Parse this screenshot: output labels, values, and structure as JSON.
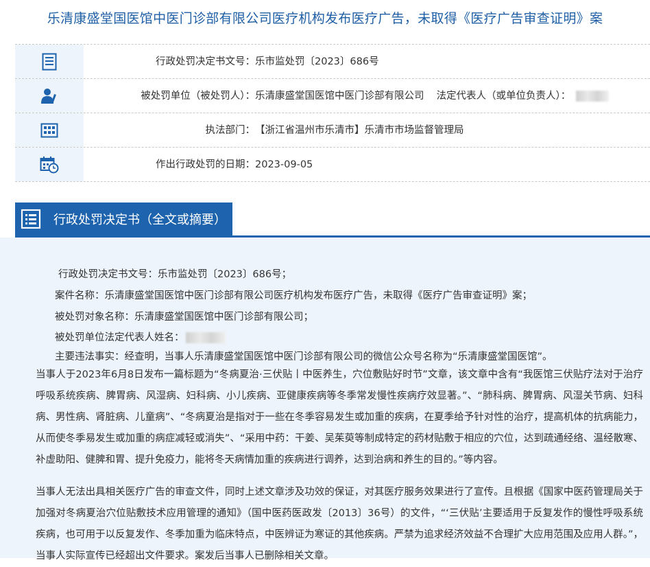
{
  "title": "乐清康盛堂国医馆中医门诊部有限公司医疗机构发布医疗广告，未取得《医疗广告审查证明》案",
  "info_rows": [
    {
      "icon": "document-icon",
      "label": "行政处罚决定书文号：",
      "value": "乐市监处罚〔2023〕686号"
    },
    {
      "icon": "user-icon",
      "label": "被处罚单位（被处罚人）：",
      "value": "乐清康盛堂国医馆中医门诊部有限公司",
      "extra_label": "法定代表人（或单位负责人）："
    },
    {
      "icon": "building-icon",
      "label": "执法部门：",
      "value": "【浙江省温州市乐清市】乐清市市场监督管理局"
    },
    {
      "icon": "calendar-clock-icon",
      "label": "作出行政处罚的日期：",
      "value": "2023-09-05"
    }
  ],
  "section": {
    "title": "行政处罚决定书（全文或摘要）",
    "icon": "document-list-icon"
  },
  "document": {
    "lines": [
      "行政处罚决定书文号：乐市监处罚〔2023〕686号；",
      "案件名称：乐清康盛堂国医馆中医门诊部有限公司医疗机构发布医疗广告，未取得《医疗广告审查证明》案；",
      "被处罚对象名称：乐清康盛堂国医馆中医门诊部有限公司；",
      "被处罚单位法定代表人姓名：",
      "主要违法事实：经查明，当事人乐清康盛堂国医馆中医门诊部有限公司的微信公众号名称为“乐清康盛堂国医馆”。"
    ],
    "paragraphs": [
      "当事人于2023年6月8日发布一篇标题为“冬病夏治·三伏贴丨中医养生，穴位敷贴好时节”文章，该文章中含有“我医馆三伏贴疗法对于治疗呼吸系统疾病、脾胃病、风湿病、妇科病、小儿疾病、亚健康疾病等冬季常发慢性疾病疗效显著。”、“肺科病、脾胃病、风湿关节病、妇科病、男性病、肾脏病、儿童病”、“冬病夏治是指对于一些在冬季容易发生或加重的疾病，在夏季给予针对性的治疗，提高机体的抗病能力，从而使冬季易发生或加重的病症减轻或消失”、“采用中药：干姜、吴茱萸等制成特定的药材贴敷于相应的穴位，达到疏通经络、温经散寒、补虚助阳、健脾和胃、提升免疫力，能将冬天病情加重的疾病进行调养，达到治病和养生的目的。”等内容。",
      "当事人无法出具相关医疗广告的审查文件，同时上述文章涉及功效的保证，对其医疗服务效果进行了宣传。且根据《国家中医药管理局关于加强对冬病夏治穴位贴敷技术应用管理的通知》（国中医药医政发〔2013〕36号）的文件，“‘三伏贴’主要适用于反复发作的慢性呼吸系统疾病，也可用于以反复发作、冬季加重为临床特点，中医辨证为寒证的其他疾病。严禁为追求经济效益不合理扩大应用范围及应用人群。”，当事人实际宣传已经超出文件要求。案发后当事人已删除相关文章。"
    ]
  },
  "colors": {
    "accent": "#1d63ad",
    "title": "#1f5fa6",
    "panel": "#eef4fb"
  }
}
